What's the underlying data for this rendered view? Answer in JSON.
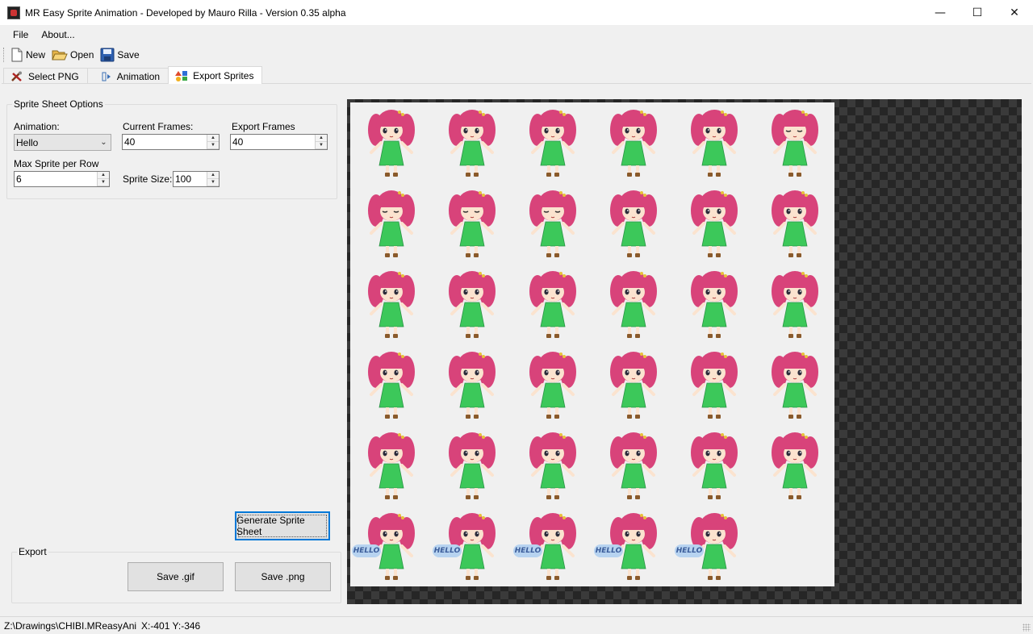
{
  "window": {
    "title": "MR Easy Sprite Animation - Developed by Mauro Rilla - Version 0.35 alpha",
    "minimize": "—",
    "maximize": "☐",
    "close": "✕"
  },
  "menu": {
    "file": "File",
    "about": "About..."
  },
  "toolbar": {
    "new": "New",
    "open": "Open",
    "save": "Save"
  },
  "tabs": [
    {
      "label": "Select PNG",
      "icon": "tools-icon"
    },
    {
      "label": "Animation",
      "icon": "animation-icon"
    },
    {
      "label": "Export Sprites",
      "icon": "shapes-icon",
      "active": true
    }
  ],
  "sprite_sheet_options": {
    "title": "Sprite Sheet Options",
    "animation_label": "Animation:",
    "animation_value": "Hello",
    "current_frames_label": "Current Frames:",
    "current_frames_value": "40",
    "export_frames_label": "Export Frames",
    "export_frames_value": "40",
    "max_sprite_label": "Max Sprite per Row",
    "max_sprite_value": "6",
    "sprite_size_label": "Sprite Size:",
    "sprite_size_value": "100"
  },
  "generate_button": "Generate Sprite Sheet",
  "export": {
    "title": "Export",
    "save_gif": "Save .gif",
    "save_png": "Save .png"
  },
  "sprite_sheet": {
    "columns": 6,
    "frame_count": 35,
    "bubble_text": "HELLO",
    "bubble_frames": [
      30,
      31,
      32,
      33,
      34
    ],
    "closed_eye_frames": [
      5,
      6,
      7,
      8
    ],
    "colors": {
      "hair": "#d8437a",
      "dress": "#3cc85a",
      "skin": "#fbe3cf",
      "background": "#f0f0f0",
      "checker_dark": "#262626",
      "checker_light": "#3a3a3a"
    }
  },
  "status": {
    "path": "Z:\\Drawings\\CHIBI.MReasyAni",
    "coords": "X:-401 Y:-346"
  }
}
